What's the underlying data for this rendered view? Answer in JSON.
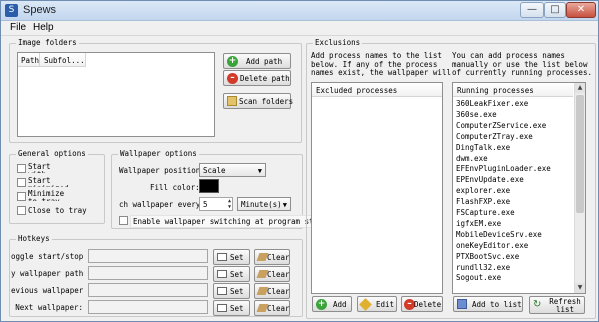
{
  "window": {
    "title": "Spews",
    "minimize": "—",
    "maximize": "□",
    "close": "✕"
  },
  "menu": {
    "file": "File",
    "help": "Help"
  },
  "image_folders": {
    "title": "Image folders",
    "columns": [
      "Path",
      "Subfol..."
    ],
    "add_path": "Add path",
    "delete_path": "Delete path",
    "scan_folders": "Scan folders"
  },
  "general_options": {
    "title": "General options",
    "items": [
      "Start with Windows",
      "Start minimized",
      "Minimize to tray",
      "Close to tray"
    ]
  },
  "wallpaper_options": {
    "title": "Wallpaper options",
    "position_label": "Wallpaper position:",
    "position_value": "Scale",
    "fill_color_label": "Fill color:",
    "fill_color": "#000000",
    "switch_label": "ch wallpaper every:",
    "switch_value": "5",
    "switch_unit": "Minute(s)",
    "enable_label": "Enable wallpaper switching at program startup"
  },
  "hotkeys": {
    "title": "Hotkeys",
    "rows": [
      {
        "label": "oggle start/stop:",
        "set": "Set",
        "clear": "Clear"
      },
      {
        "label": "y wallpaper path:",
        "set": "Set",
        "clear": "Clear"
      },
      {
        "label": "evious wallpaper:",
        "set": "Set",
        "clear": "Clear"
      },
      {
        "label": "Next wallpaper:",
        "set": "Set",
        "clear": "Clear"
      }
    ]
  },
  "exclusions": {
    "title": "Exclusions",
    "desc_left": [
      "Add process names to the list",
      "below.  If any of the process",
      "names exist, the wallpaper will"
    ],
    "desc_right": [
      "You can add process names",
      "manually or use the list below",
      "of currently running processes."
    ],
    "excluded_header": "Excluded processes",
    "running_header": "Running processes",
    "running": [
      "360LeakFixer.exe",
      "360se.exe",
      "ComputerZService.exe",
      "ComputerZTray.exe",
      "DingTalk.exe",
      "dwm.exe",
      "EFEnvPluginLoader.exe",
      "EPEnvUpdate.exe",
      "explorer.exe",
      "FlashFXP.exe",
      "FSCapture.exe",
      "igfxEM.exe",
      "MobileDeviceSrv.exe",
      "oneKeyEditor.exe",
      "PTXBootSvc.exe",
      "rundll32.exe",
      "Sogout.exe"
    ],
    "add": "Add",
    "edit": "Edit",
    "delete": "Delete",
    "add_to_list": "Add to list",
    "refresh_list": "Refresh list"
  }
}
